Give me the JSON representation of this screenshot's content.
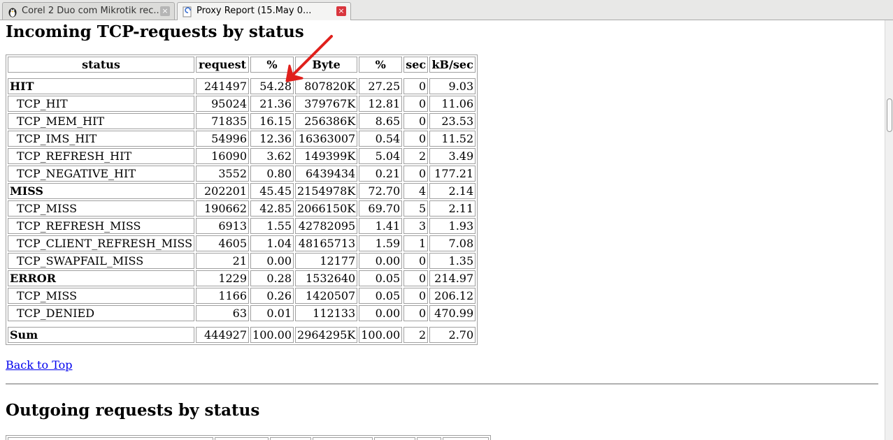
{
  "tabs": [
    {
      "label": "Corel 2 Duo com Mikrotik rec...",
      "close": "×",
      "icon": "penguin-icon"
    },
    {
      "label": "Proxy Report (15.May 0...",
      "close": "×",
      "icon": "page-loading-icon"
    }
  ],
  "section1": {
    "title": "Incoming TCP-requests by status",
    "headers": [
      "status",
      "request",
      "%",
      "Byte",
      "%",
      "sec",
      "kB/sec"
    ],
    "rows": [
      {
        "status": "HIT",
        "request": "241497",
        "pct1": "54.28",
        "byte": "807820K",
        "pct2": "27.25",
        "sec": "0",
        "kbs": "9.03",
        "group": true
      },
      {
        "status": "TCP_HIT",
        "request": "95024",
        "pct1": "21.36",
        "byte": "379767K",
        "pct2": "12.81",
        "sec": "0",
        "kbs": "11.06",
        "group": false
      },
      {
        "status": "TCP_MEM_HIT",
        "request": "71835",
        "pct1": "16.15",
        "byte": "256386K",
        "pct2": "8.65",
        "sec": "0",
        "kbs": "23.53",
        "group": false
      },
      {
        "status": "TCP_IMS_HIT",
        "request": "54996",
        "pct1": "12.36",
        "byte": "16363007",
        "pct2": "0.54",
        "sec": "0",
        "kbs": "11.52",
        "group": false
      },
      {
        "status": "TCP_REFRESH_HIT",
        "request": "16090",
        "pct1": "3.62",
        "byte": "149399K",
        "pct2": "5.04",
        "sec": "2",
        "kbs": "3.49",
        "group": false
      },
      {
        "status": "TCP_NEGATIVE_HIT",
        "request": "3552",
        "pct1": "0.80",
        "byte": "6439434",
        "pct2": "0.21",
        "sec": "0",
        "kbs": "177.21",
        "group": false
      },
      {
        "status": "MISS",
        "request": "202201",
        "pct1": "45.45",
        "byte": "2154978K",
        "pct2": "72.70",
        "sec": "4",
        "kbs": "2.14",
        "group": true
      },
      {
        "status": "TCP_MISS",
        "request": "190662",
        "pct1": "42.85",
        "byte": "2066150K",
        "pct2": "69.70",
        "sec": "5",
        "kbs": "2.11",
        "group": false
      },
      {
        "status": "TCP_REFRESH_MISS",
        "request": "6913",
        "pct1": "1.55",
        "byte": "42782095",
        "pct2": "1.41",
        "sec": "3",
        "kbs": "1.93",
        "group": false
      },
      {
        "status": "TCP_CLIENT_REFRESH_MISS",
        "request": "4605",
        "pct1": "1.04",
        "byte": "48165713",
        "pct2": "1.59",
        "sec": "1",
        "kbs": "7.08",
        "group": false
      },
      {
        "status": "TCP_SWAPFAIL_MISS",
        "request": "21",
        "pct1": "0.00",
        "byte": "12177",
        "pct2": "0.00",
        "sec": "0",
        "kbs": "1.35",
        "group": false
      },
      {
        "status": "ERROR",
        "request": "1229",
        "pct1": "0.28",
        "byte": "1532640",
        "pct2": "0.05",
        "sec": "0",
        "kbs": "214.97",
        "group": true
      },
      {
        "status": "TCP_MISS",
        "request": "1166",
        "pct1": "0.26",
        "byte": "1420507",
        "pct2": "0.05",
        "sec": "0",
        "kbs": "206.12",
        "group": false
      },
      {
        "status": "TCP_DENIED",
        "request": "63",
        "pct1": "0.01",
        "byte": "112133",
        "pct2": "0.00",
        "sec": "0",
        "kbs": "470.99",
        "group": false
      }
    ],
    "sum": {
      "status": "Sum",
      "request": "444927",
      "pct1": "100.00",
      "byte": "2964295K",
      "pct2": "100.00",
      "sec": "2",
      "kbs": "2.70"
    }
  },
  "back_to_top": "Back to Top",
  "section2": {
    "title": "Outgoing requests by status"
  },
  "colors": {
    "link": "#0000ee",
    "arrow": "#e0201c",
    "close_active": "#d9363e"
  }
}
